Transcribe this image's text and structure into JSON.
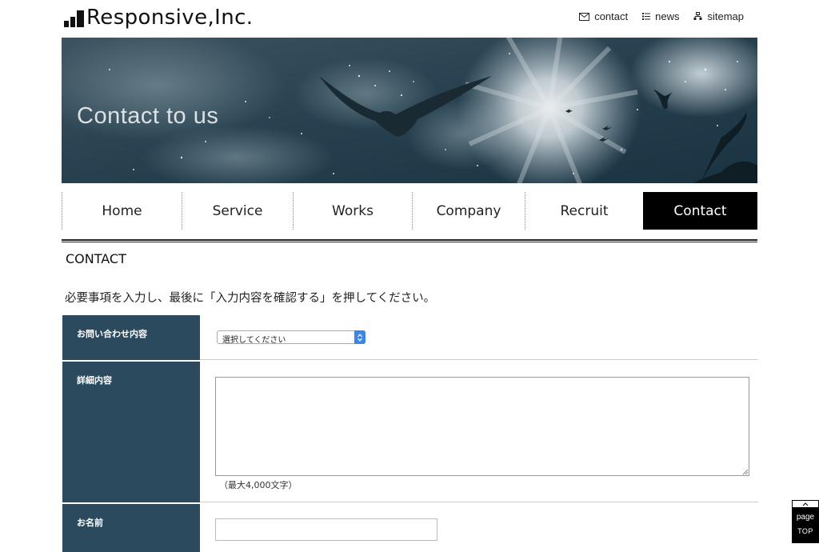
{
  "header": {
    "logo_text": "Responsive,Inc.",
    "links": [
      {
        "label": "contact",
        "icon": "mail-icon"
      },
      {
        "label": "news",
        "icon": "list-icon"
      },
      {
        "label": "sitemap",
        "icon": "sitemap-icon"
      }
    ]
  },
  "hero": {
    "title": "Contact to us"
  },
  "nav": {
    "items": [
      {
        "label": "Home"
      },
      {
        "label": "Service"
      },
      {
        "label": "Works"
      },
      {
        "label": "Company"
      },
      {
        "label": "Recruit"
      },
      {
        "label": "Contact",
        "active": true
      }
    ]
  },
  "main": {
    "section_title": "CONTACT",
    "instruction": "必要事項を入力し、最後に「入力内容を確認する」を押してください。",
    "form": {
      "inquiry_label": "お問い合わせ内容",
      "inquiry_select_value": "選択してください",
      "detail_label": "詳細内容",
      "detail_value": "",
      "detail_note": "（最大4,000文字）",
      "name_label": "お名前",
      "name_value": ""
    }
  },
  "page_top": {
    "line1": "page",
    "line2": "TOP"
  },
  "colors": {
    "label_bg": "#2c4a5d",
    "active_nav_bg": "#000000",
    "select_arrow": "#3b86e6"
  }
}
